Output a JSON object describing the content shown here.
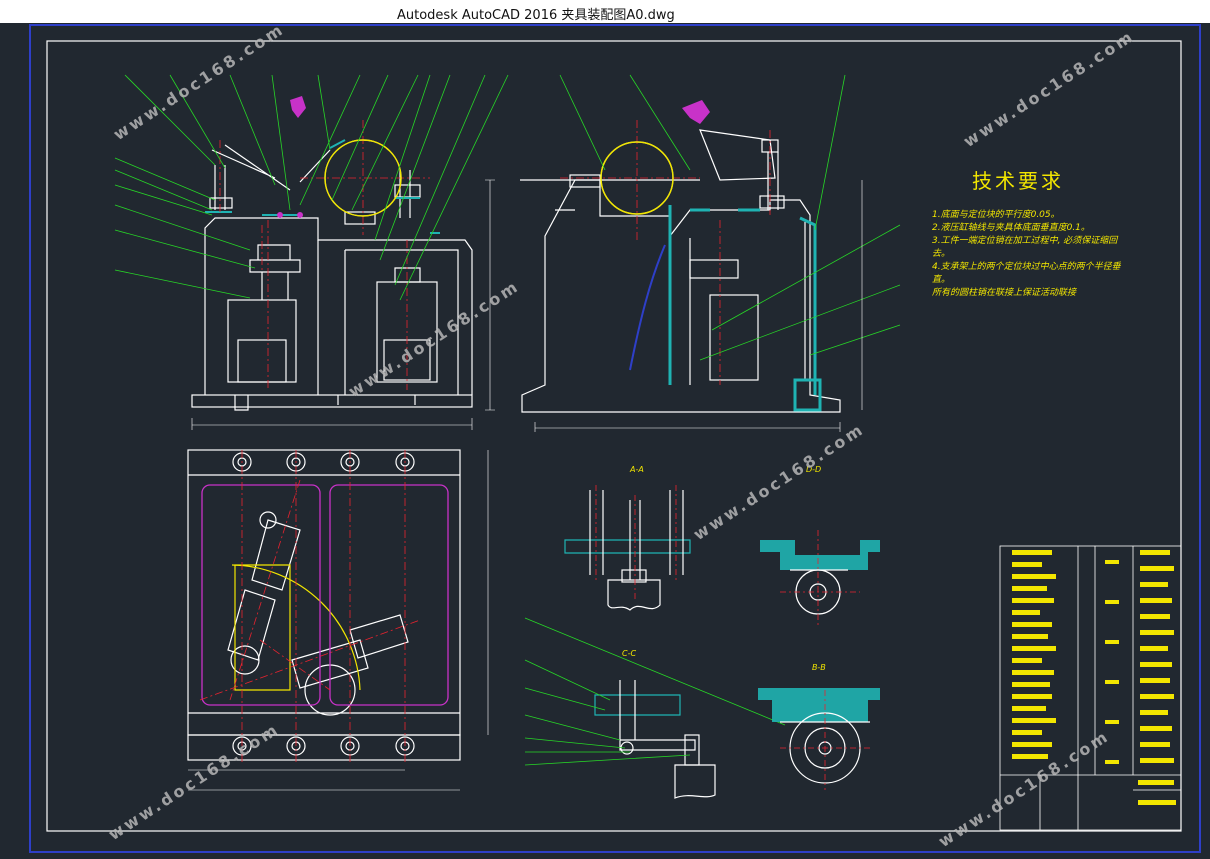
{
  "window": {
    "title": "Autodesk AutoCAD 2016     夹具装配图A0.dwg"
  },
  "technical_requirements": {
    "title": "技术要求",
    "lines": [
      "1.底面与定位块的平行度0.05。",
      "2.液压缸轴线与夹具体底面垂直度0.1。",
      "3.工件一端定位销在加工过程中, 必须保证缩回",
      "  去。",
      "4.支承架上的两个定位块过中心点的两个半径垂",
      "  直。",
      "  所有的圆柱销在联接上保证活动联接"
    ]
  },
  "section_labels": {
    "a": "A-A",
    "b": "B-B",
    "c": "C-C",
    "d": "D-D"
  },
  "watermark": {
    "text": "www.doc168.com"
  },
  "colors": {
    "background": "#212830",
    "outline": "#ffffff",
    "leader": "#27d627",
    "center": "#e8232f",
    "hatch": "#1fb3b3",
    "part": "#c832c8",
    "text": "#f2e600",
    "border": "#2e3fc8"
  }
}
